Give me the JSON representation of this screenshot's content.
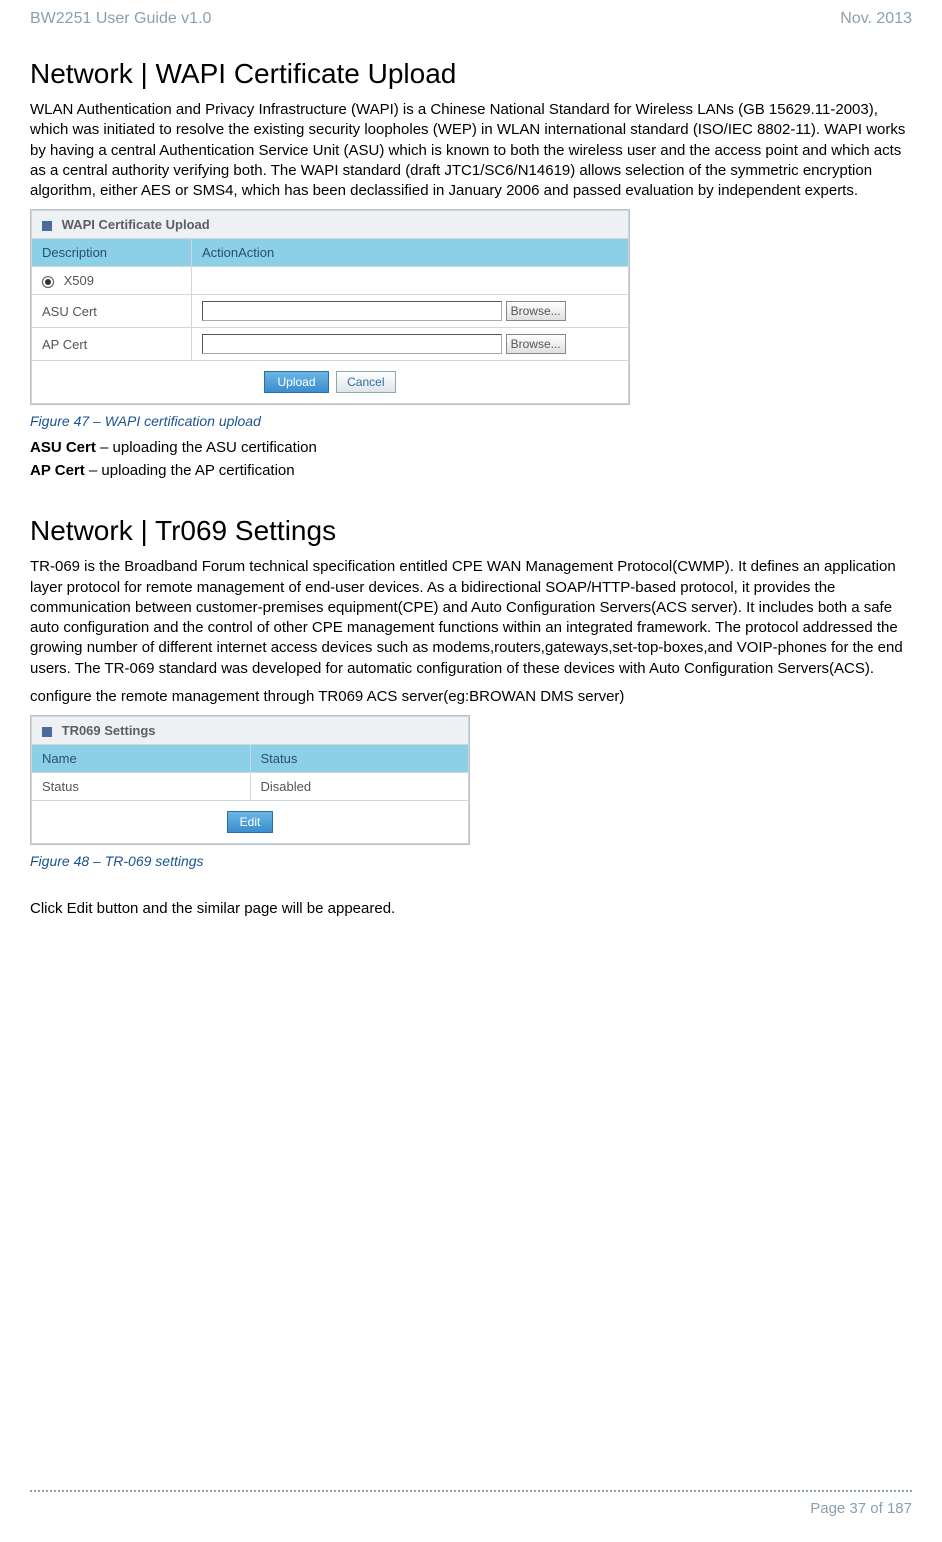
{
  "header": {
    "left": "BW2251 User Guide v1.0",
    "right": "Nov.  2013"
  },
  "section1": {
    "title": "Network | WAPI Certificate Upload",
    "para": "WLAN Authentication and Privacy Infrastructure (WAPI) is a Chinese National Standard for Wireless LANs (GB 15629.11-2003), which was initiated to resolve the existing security loopholes (WEP) in WLAN international standard (ISO/IEC 8802-11). WAPI works by having a central Authentication Service Unit (ASU) which is known to both the wireless user and the access point and which acts as a central authority verifying both. The WAPI standard (draft JTC1/SC6/N14619) allows selection of the symmetric encryption algorithm, either AES or SMS4, which has been declassified in January 2006 and passed evaluation by independent experts.",
    "panel": {
      "title": "WAPI Certificate Upload",
      "head_desc": "Description",
      "head_action": "ActionAction",
      "row_x509": "X509",
      "row_asu": "ASU Cert",
      "row_ap": "AP Cert",
      "browse": "Browse...",
      "upload": "Upload",
      "cancel": "Cancel"
    },
    "caption": "Figure 47 – WAPI certification upload",
    "def1_label": "ASU Cert",
    "def1_text": " – uploading the ASU certification",
    "def2_label": "AP Cert",
    "def2_text": " –  uploading the AP certification"
  },
  "section2": {
    "title": "Network | Tr069 Settings",
    "para1": "TR-069 is the Broadband Forum technical specification entitled CPE WAN Management Protocol(CWMP). It defines an application layer protocol for remote management of end-user devices. As a bidirectional SOAP/HTTP-based protocol, it provides the communication between customer-premises equipment(CPE) and Auto Configuration Servers(ACS server). It includes both a safe auto configuration and the control of other CPE management functions within an integrated framework. The protocol addressed the growing number of different internet access devices such as modems,routers,gateways,set-top-boxes,and VOIP-phones for the end users. The TR-069 standard was developed for automatic configuration of these devices with Auto Configuration Servers(ACS).",
    "para2": "configure the remote management through TR069 ACS server(eg:BROWAN DMS server)",
    "panel": {
      "title": "TR069 Settings",
      "head_name": "Name",
      "head_status": "Status",
      "row_label": "Status",
      "row_value": "Disabled",
      "edit": "Edit"
    },
    "caption": "Figure 48 – TR-069 settings",
    "para3": "Click Edit button and the similar page will be appeared."
  },
  "footer": "Page 37 of 187"
}
